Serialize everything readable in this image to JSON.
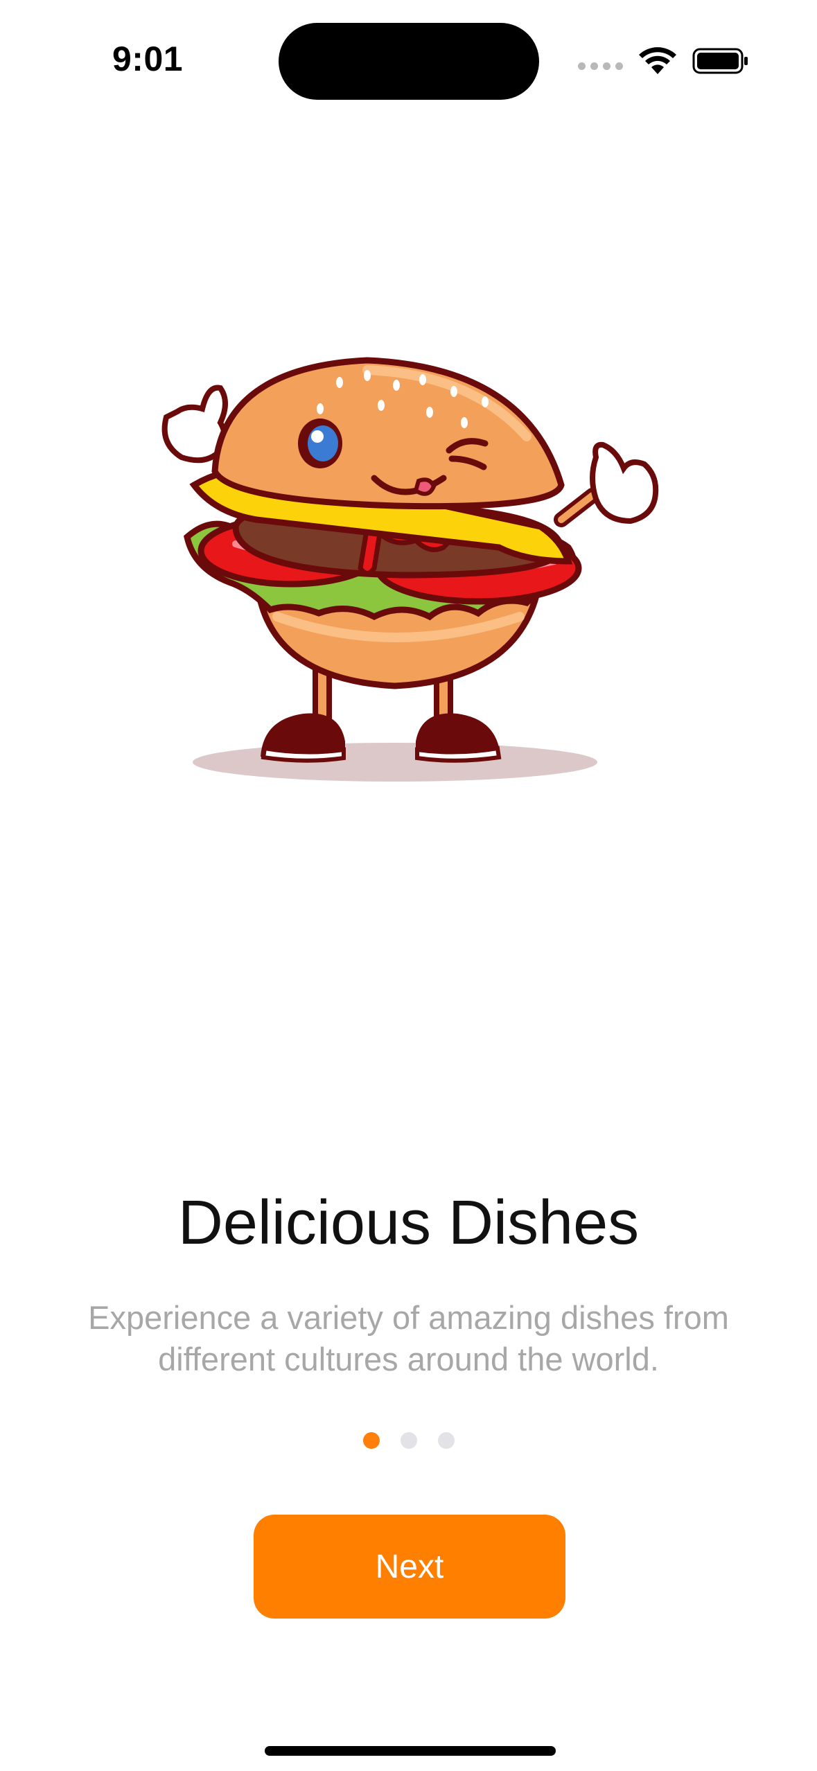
{
  "status_bar": {
    "time": "9:01"
  },
  "onboarding": {
    "illustration": "burger-mascot-illustration",
    "title": "Delicious Dishes",
    "subtitle": "Experience a variety of amazing dishes from different cultures around the world.",
    "page_count": 3,
    "current_page": 1,
    "next_label": "Next"
  },
  "colors": {
    "accent": "#ff7f00",
    "inactive_dot": "#e2e2e7",
    "subtitle": "#a7a7a7"
  }
}
